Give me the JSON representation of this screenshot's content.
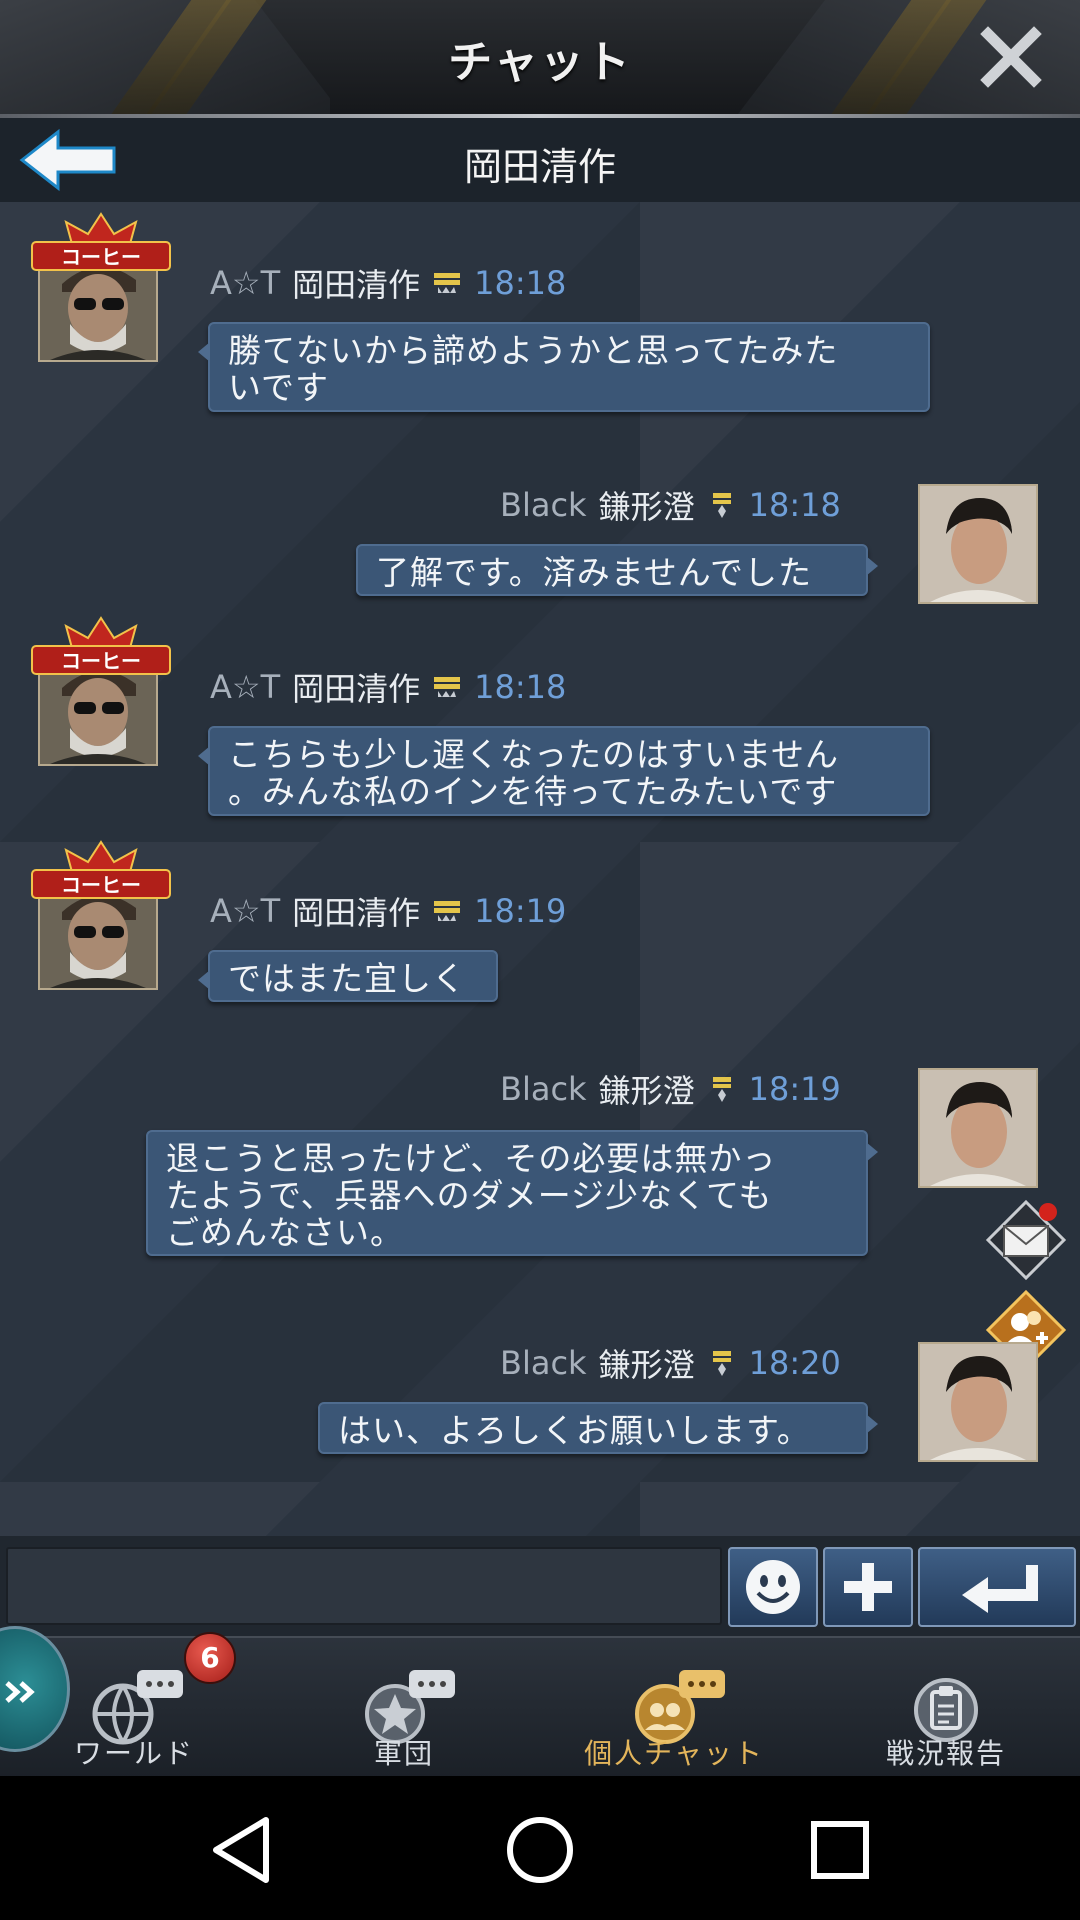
{
  "window": {
    "title": "チャット"
  },
  "conversation": {
    "title": "岡田清作"
  },
  "messages": [
    {
      "side": "left",
      "badge": "コーヒー",
      "alias": "A☆T",
      "name": "岡田清作",
      "time": "18:18",
      "lines": [
        "勝てないから諦めようかと思ってたみた",
        "いです"
      ]
    },
    {
      "side": "right",
      "alias": "Black",
      "name": "鎌形澄",
      "time": "18:18",
      "lines": [
        "了解です。済みませんでした"
      ]
    },
    {
      "side": "left",
      "badge": "コーヒー",
      "alias": "A☆T",
      "name": "岡田清作",
      "time": "18:18",
      "lines": [
        "こちらも少し遅くなったのはすいません",
        "。みんな私のインを待ってたみたいです"
      ]
    },
    {
      "side": "left",
      "badge": "コーヒー",
      "alias": "A☆T",
      "name": "岡田清作",
      "time": "18:19",
      "lines": [
        "ではまた宜しく"
      ]
    },
    {
      "side": "right",
      "alias": "Black",
      "name": "鎌形澄",
      "time": "18:19",
      "lines": [
        "退こうと思ったけど、その必要は無かっ",
        "たようで、兵器へのダメージ少なくても",
        "ごめんなさい。"
      ]
    },
    {
      "side": "right",
      "alias": "Black",
      "name": "鎌形澄",
      "time": "18:20",
      "lines": [
        "はい、よろしくお願いします。"
      ]
    }
  ],
  "input": {
    "value": "",
    "placeholder": ""
  },
  "bottom_nav": [
    {
      "label": "ワールド",
      "badge": "6",
      "icon": "globe-chat-icon"
    },
    {
      "label": "軍団",
      "icon": "star-emblem-chat-icon"
    },
    {
      "label": "個人チャット",
      "icon": "personal-chat-icon",
      "active": true
    },
    {
      "label": "戦況報告",
      "icon": "clipboard-report-icon"
    }
  ],
  "colors": {
    "accent_time": "#6f9fd8",
    "bubble": "#3b5676",
    "active_tab": "#e3b55b",
    "badge_red": "#c8281f"
  }
}
